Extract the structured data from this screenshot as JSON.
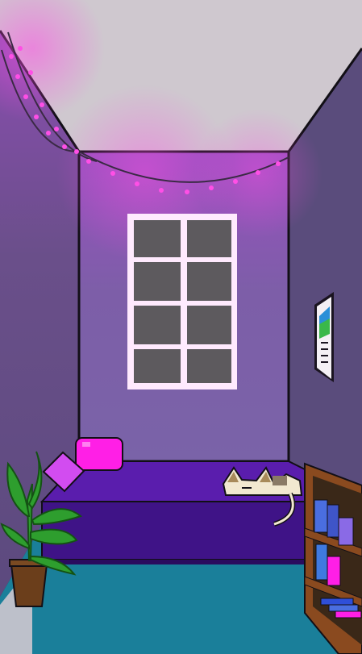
{
  "scene": {
    "description_free": true,
    "palette": {
      "ceiling": "#cfc8cf",
      "left_wall": "#6a4f8a",
      "right_wall": "#5a4c7c",
      "back_wall": "#7d5ea8",
      "floor": "#1a7f9a",
      "bed": "#5a1dad",
      "bed_dark": "#3f1387",
      "pillow": "#ff1fe6",
      "pillow2": "#d24cf0",
      "lights": "#ff4fe6",
      "window_frame": "#ffeafe",
      "window_glass": "#5d5a5e",
      "plant": "#2e9e2e",
      "pot": "#6b3e1b",
      "shelf": "#8a4a1f"
    },
    "items": [
      "string-lights",
      "window",
      "poster",
      "bed",
      "pillow",
      "cushion",
      "cat",
      "potted-plant",
      "bookshelf"
    ]
  }
}
